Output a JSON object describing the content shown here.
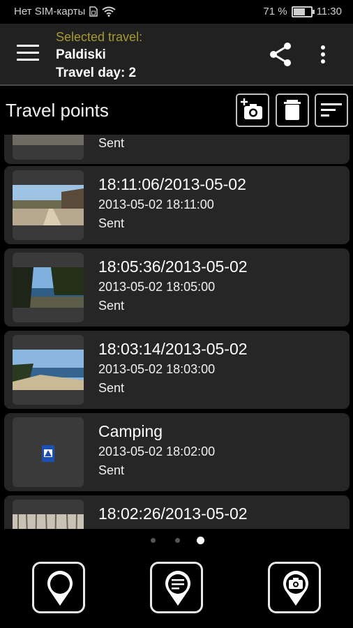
{
  "status_bar": {
    "carrier": "Нет SIM-карты",
    "battery": "71 %",
    "battery_level": 0.71,
    "time": "11:30"
  },
  "app_bar": {
    "selected_label": "Selected travel:",
    "travel_name": "Paldiski",
    "travel_day": "Travel day: 2",
    "icons": {
      "menu": "hamburger-menu-icon",
      "share": "share-icon",
      "more": "more-vert-icon"
    }
  },
  "section": {
    "title": "Travel points",
    "toolbar_icons": [
      "add-photo-icon",
      "trash-icon",
      "sort-icon"
    ]
  },
  "points": [
    {
      "title": "",
      "date": "",
      "status": "Sent",
      "thumb": "photo"
    },
    {
      "title": "18:11:06/2013-05-02",
      "date": "2013-05-02 18:11:00",
      "status": "Sent",
      "thumb": "photo"
    },
    {
      "title": "18:05:36/2013-05-02",
      "date": "2013-05-02 18:05:00",
      "status": "Sent",
      "thumb": "photo"
    },
    {
      "title": "18:03:14/2013-05-02",
      "date": "2013-05-02 18:03:00",
      "status": "Sent",
      "thumb": "photo"
    },
    {
      "title": "Camping",
      "date": "2013-05-02 18:02:00",
      "status": "Sent",
      "thumb": "camping-icon"
    },
    {
      "title": "18:02:26/2013-05-02",
      "date": "",
      "status": "",
      "thumb": "photo"
    }
  ],
  "pager": {
    "pages": 3,
    "active": 3
  },
  "bottom_nav": {
    "icons": [
      "map-pin-icon",
      "note-pin-icon",
      "camera-pin-icon"
    ]
  },
  "colors": {
    "accent_label": "#a9992e",
    "card_bg": "#262626",
    "app_bar_bg": "#212121",
    "camping_sign": "#1c4fb3"
  }
}
